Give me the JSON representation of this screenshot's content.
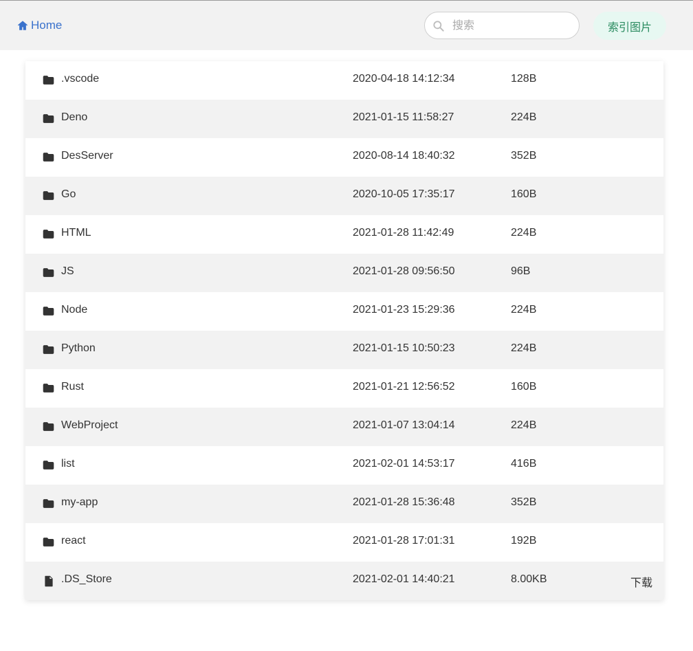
{
  "header": {
    "home_label": "Home",
    "search_placeholder": "搜索",
    "index_button_label": "索引图片"
  },
  "files": [
    {
      "icon": "folder-icon",
      "name": ".vscode",
      "date": "2020-04-18 14:12:34",
      "size": "128B",
      "action": ""
    },
    {
      "icon": "folder-icon",
      "name": "Deno",
      "date": "2021-01-15 11:58:27",
      "size": "224B",
      "action": ""
    },
    {
      "icon": "folder-icon",
      "name": "DesServer",
      "date": "2020-08-14 18:40:32",
      "size": "352B",
      "action": ""
    },
    {
      "icon": "folder-icon",
      "name": "Go",
      "date": "2020-10-05 17:35:17",
      "size": "160B",
      "action": ""
    },
    {
      "icon": "folder-icon",
      "name": "HTML",
      "date": "2021-01-28 11:42:49",
      "size": "224B",
      "action": ""
    },
    {
      "icon": "folder-icon",
      "name": "JS",
      "date": "2021-01-28 09:56:50",
      "size": "96B",
      "action": ""
    },
    {
      "icon": "folder-icon",
      "name": "Node",
      "date": "2021-01-23 15:29:36",
      "size": "224B",
      "action": ""
    },
    {
      "icon": "folder-icon",
      "name": "Python",
      "date": "2021-01-15 10:50:23",
      "size": "224B",
      "action": ""
    },
    {
      "icon": "folder-icon",
      "name": "Rust",
      "date": "2021-01-21 12:56:52",
      "size": "160B",
      "action": ""
    },
    {
      "icon": "folder-icon",
      "name": "WebProject",
      "date": "2021-01-07 13:04:14",
      "size": "224B",
      "action": ""
    },
    {
      "icon": "folder-icon",
      "name": "list",
      "date": "2021-02-01 14:53:17",
      "size": "416B",
      "action": ""
    },
    {
      "icon": "folder-icon",
      "name": "my-app",
      "date": "2021-01-28 15:36:48",
      "size": "352B",
      "action": ""
    },
    {
      "icon": "folder-icon",
      "name": "react",
      "date": "2021-01-28 17:01:31",
      "size": "192B",
      "action": ""
    },
    {
      "icon": "file-icon",
      "name": ".DS_Store",
      "date": "2021-02-01 14:40:21",
      "size": "8.00KB",
      "action": "下载"
    }
  ],
  "colors": {
    "link": "#3a72cc",
    "button_bg": "#e7f8f2",
    "button_text": "#2a8b60",
    "header_bg": "#f2f2f2",
    "striped_row_bg": "#f2f2f2"
  }
}
